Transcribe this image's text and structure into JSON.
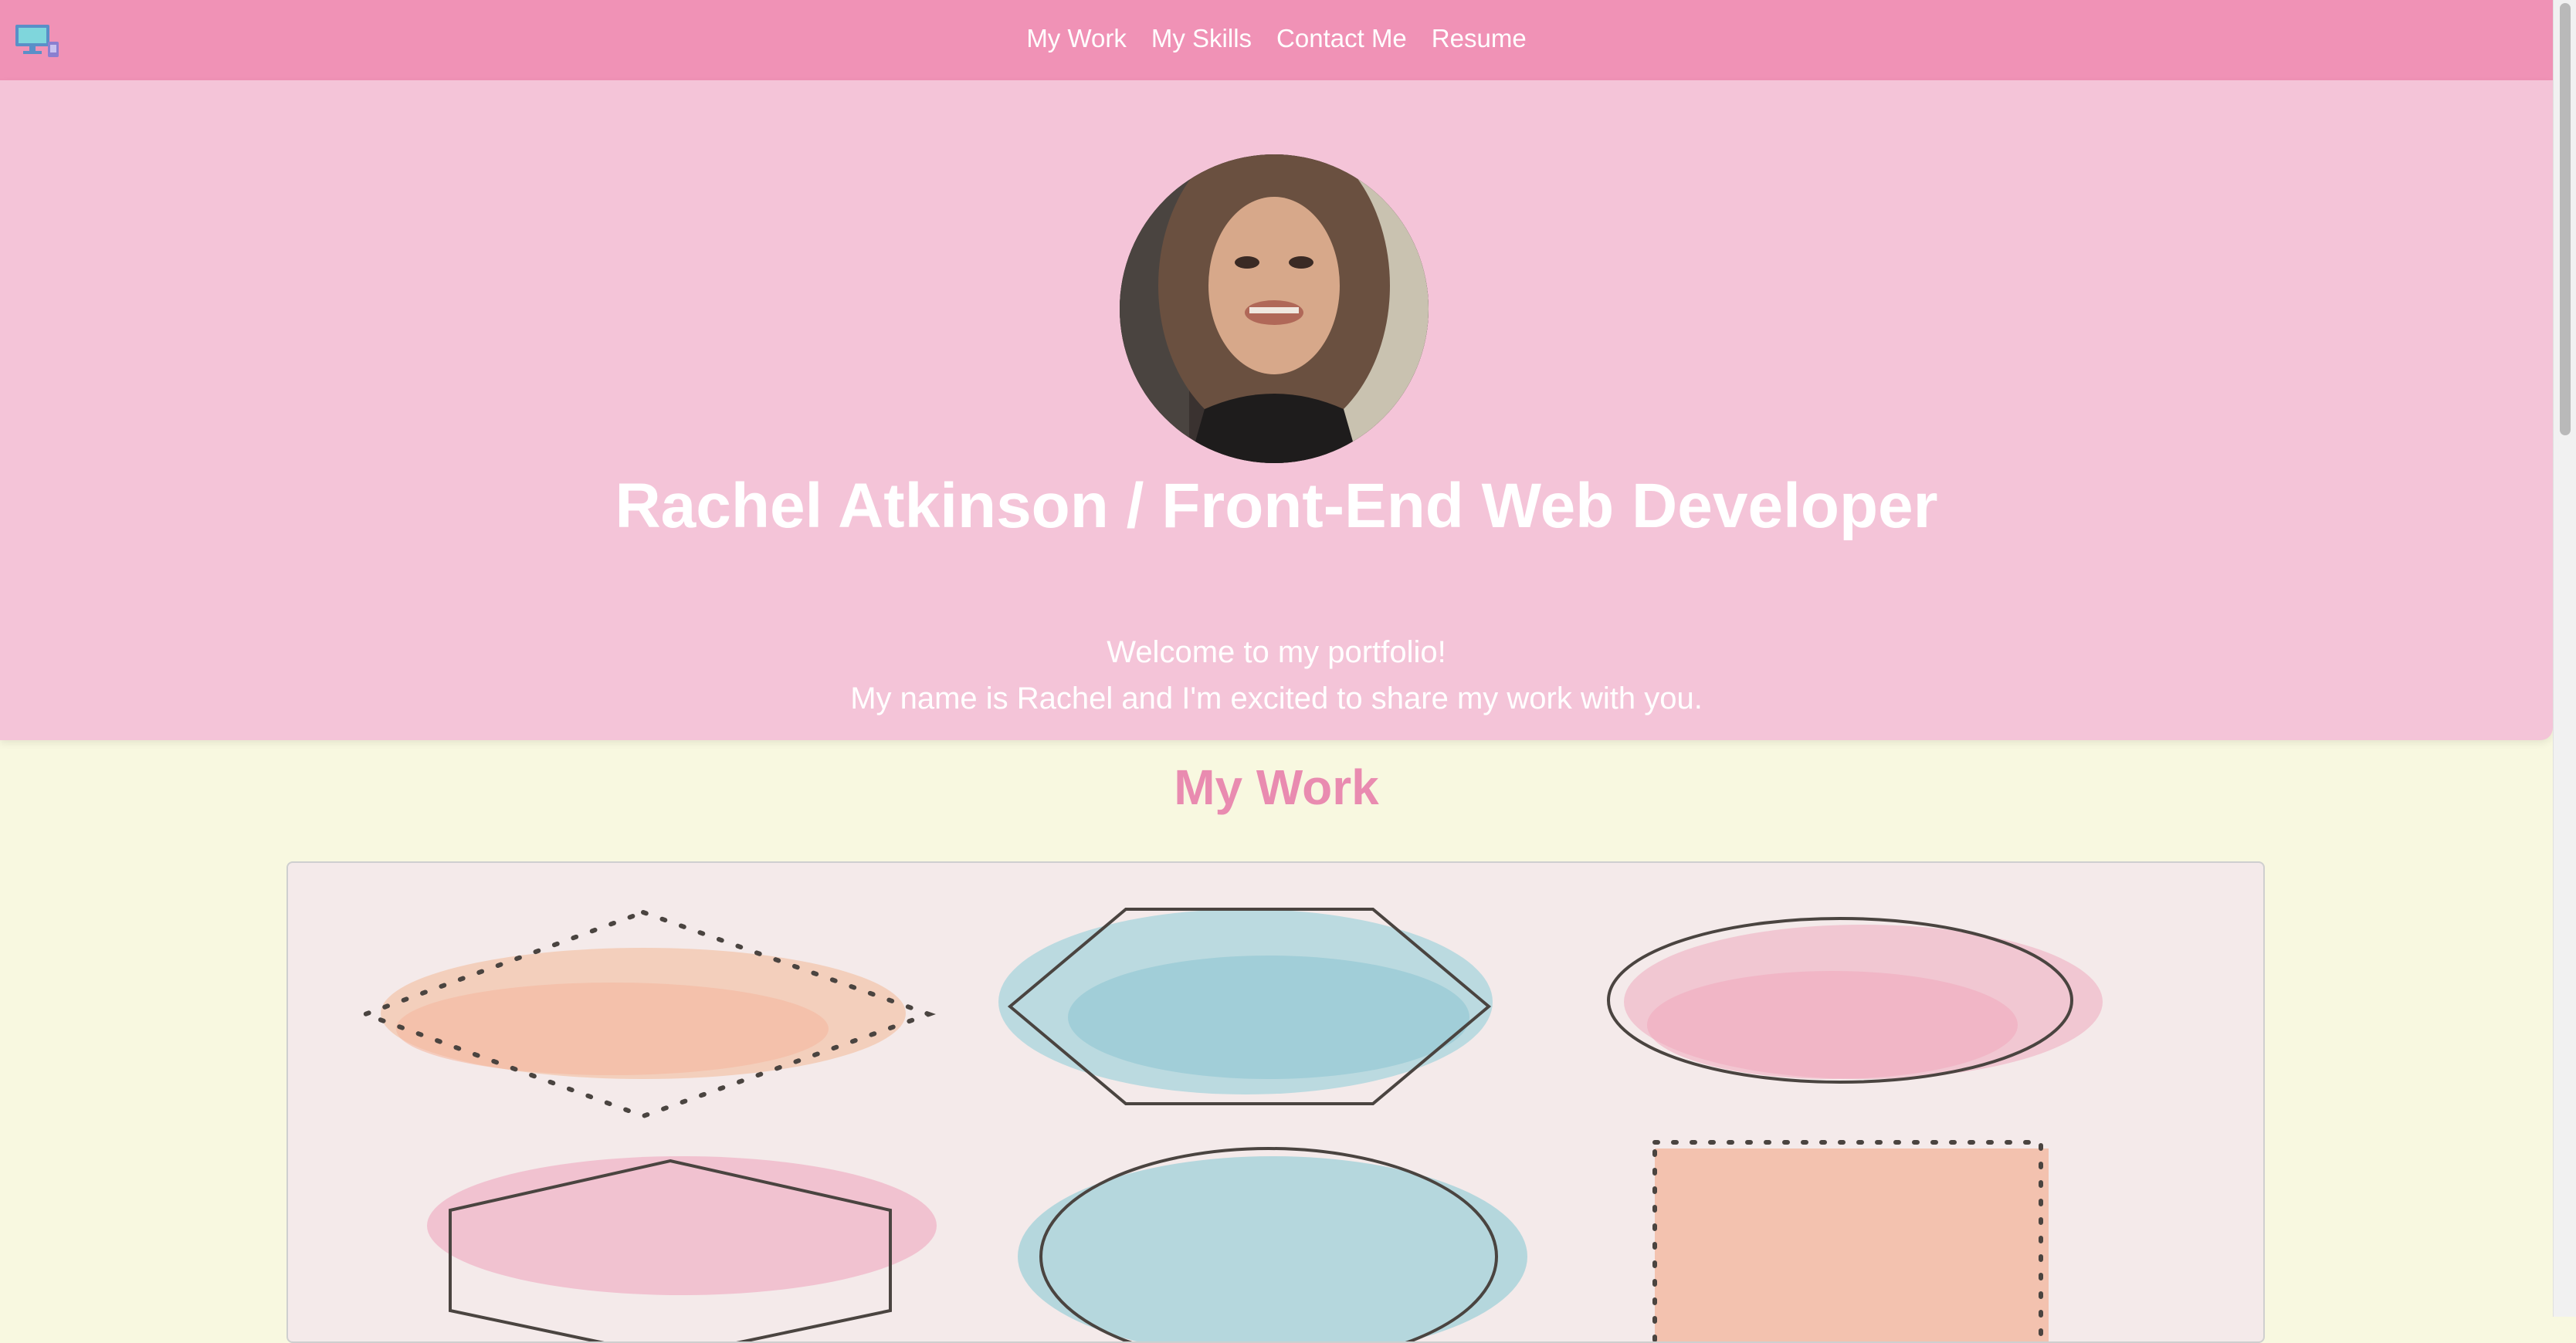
{
  "nav": {
    "logo_icon": "computer-monitor-icon",
    "links": [
      "My Work",
      "My Skills",
      "Contact Me",
      "Resume"
    ]
  },
  "hero": {
    "title": "Rachel Atkinson / Front-End Web Developer",
    "line1": "Welcome to my portfolio!",
    "line2": "My name is Rachel and I'm excited to share my work with you."
  },
  "work": {
    "title": "My Work"
  },
  "colors": {
    "navbar": "#f092b6",
    "hero": "#f4c4d8",
    "page": "#f8f8e0",
    "accent": "#e98bb0",
    "panel": "#f4eaea"
  }
}
